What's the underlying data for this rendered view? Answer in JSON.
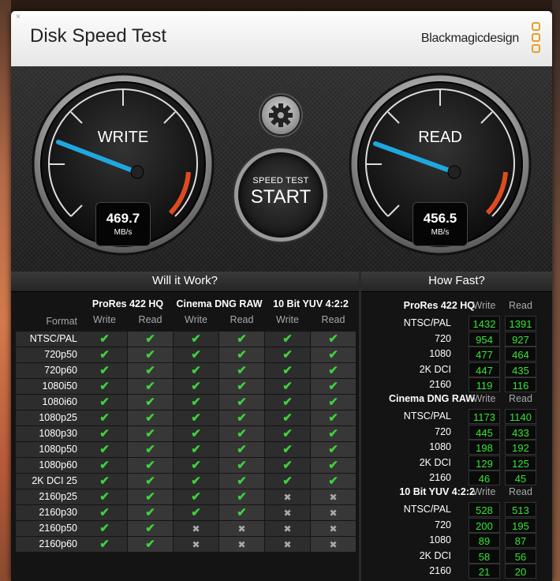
{
  "window": {
    "title": "Disk Speed Test",
    "brand": "Blackmagicdesign"
  },
  "gauges": {
    "write": {
      "label": "WRITE",
      "value": "469.7",
      "unit": "MB/s"
    },
    "read": {
      "label": "READ",
      "value": "456.5",
      "unit": "MB/s"
    }
  },
  "buttons": {
    "start_small": "SPEED TEST",
    "start_big": "START"
  },
  "will_it_work": {
    "title": "Will it Work?",
    "format_header": "Format",
    "groups": [
      "ProRes 422 HQ",
      "Cinema DNG RAW",
      "10 Bit YUV 4:2:2"
    ],
    "write_label": "Write",
    "read_label": "Read",
    "rows": [
      {
        "format": "NTSC/PAL",
        "results": [
          true,
          true,
          true,
          true,
          true,
          true
        ]
      },
      {
        "format": "720p50",
        "results": [
          true,
          true,
          true,
          true,
          true,
          true
        ]
      },
      {
        "format": "720p60",
        "results": [
          true,
          true,
          true,
          true,
          true,
          true
        ]
      },
      {
        "format": "1080i50",
        "results": [
          true,
          true,
          true,
          true,
          true,
          true
        ]
      },
      {
        "format": "1080i60",
        "results": [
          true,
          true,
          true,
          true,
          true,
          true
        ]
      },
      {
        "format": "1080p25",
        "results": [
          true,
          true,
          true,
          true,
          true,
          true
        ]
      },
      {
        "format": "1080p30",
        "results": [
          true,
          true,
          true,
          true,
          true,
          true
        ]
      },
      {
        "format": "1080p50",
        "results": [
          true,
          true,
          true,
          true,
          true,
          true
        ]
      },
      {
        "format": "1080p60",
        "results": [
          true,
          true,
          true,
          true,
          true,
          true
        ]
      },
      {
        "format": "2K DCI 25",
        "results": [
          true,
          true,
          true,
          true,
          true,
          true
        ]
      },
      {
        "format": "2160p25",
        "results": [
          true,
          true,
          true,
          true,
          false,
          false
        ]
      },
      {
        "format": "2160p30",
        "results": [
          true,
          true,
          true,
          true,
          false,
          false
        ]
      },
      {
        "format": "2160p50",
        "results": [
          true,
          true,
          false,
          false,
          false,
          false
        ]
      },
      {
        "format": "2160p60",
        "results": [
          true,
          true,
          false,
          false,
          false,
          false
        ]
      }
    ]
  },
  "how_fast": {
    "title": "How Fast?",
    "write_label": "Write",
    "read_label": "Read",
    "groups": [
      {
        "name": "ProRes 422 HQ",
        "rows": [
          {
            "format": "NTSC/PAL",
            "write": "1432",
            "read": "1391"
          },
          {
            "format": "720",
            "write": "954",
            "read": "927"
          },
          {
            "format": "1080",
            "write": "477",
            "read": "464"
          },
          {
            "format": "2K DCI",
            "write": "447",
            "read": "435"
          },
          {
            "format": "2160",
            "write": "119",
            "read": "116"
          }
        ]
      },
      {
        "name": "Cinema DNG RAW",
        "rows": [
          {
            "format": "NTSC/PAL",
            "write": "1173",
            "read": "1140"
          },
          {
            "format": "720",
            "write": "445",
            "read": "433"
          },
          {
            "format": "1080",
            "write": "198",
            "read": "192"
          },
          {
            "format": "2K DCI",
            "write": "129",
            "read": "125"
          },
          {
            "format": "2160",
            "write": "46",
            "read": "45"
          }
        ]
      },
      {
        "name": "10 Bit YUV 4:2:2",
        "rows": [
          {
            "format": "NTSC/PAL",
            "write": "528",
            "read": "513"
          },
          {
            "format": "720",
            "write": "200",
            "read": "195"
          },
          {
            "format": "1080",
            "write": "89",
            "read": "87"
          },
          {
            "format": "2K DCI",
            "write": "58",
            "read": "56"
          },
          {
            "format": "2160",
            "write": "21",
            "read": "20"
          }
        ]
      }
    ]
  },
  "colors": {
    "ok": "#3fd03f",
    "value": "#33e633",
    "needle": "#1fa8e0",
    "accent": "#e8a026"
  }
}
